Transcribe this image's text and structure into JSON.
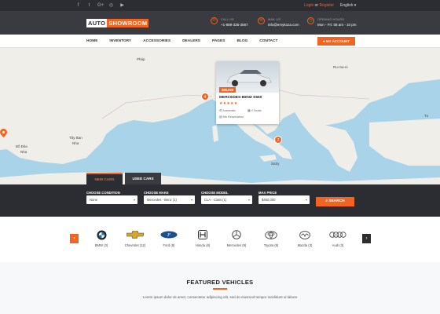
{
  "topbar": {
    "social_icons": [
      "f",
      "t",
      "G+",
      "◎",
      "▶"
    ],
    "login": "Login",
    "or": "or",
    "register": "Register",
    "language": "English"
  },
  "header": {
    "logo_a": "AUTO",
    "logo_b": "SHOWROOM",
    "call_label": "CALL US",
    "call_value": "+1-888-335-3567",
    "mail_label": "MAIL US",
    "mail_value": "info@emykoza.com",
    "hours_label": "OPENING HOURS",
    "hours_value": "Mon - Fri: 08 am - 10 pm"
  },
  "nav": {
    "items": [
      "HOME",
      "INVENTORY",
      "ACCESSORIES",
      "DEALERS",
      "PAGES",
      "BLOG",
      "CONTACT"
    ],
    "account": "MY ACCOUNT"
  },
  "map": {
    "labels": [
      "Pháp",
      "Ru-ma-ni",
      "Tây Ban",
      "Nha",
      "Bồ Đào",
      "Nha",
      "Sicily",
      "Tu"
    ],
    "pins": [
      "4",
      "2"
    ],
    "card": {
      "price": "$90,000",
      "name": "MERCEDES-BENZ S550",
      "stars": "★★★★★",
      "spec1": "Automatic",
      "spec2": "4 Seats",
      "spec3": "6th Reservation"
    }
  },
  "search": {
    "tab_new": "NEW CARS",
    "tab_used": "USED CARS",
    "fields": [
      {
        "label": "CHOOSE CONDITION",
        "value": "None"
      },
      {
        "label": "CHOOSE MAKE",
        "value": "Mercedes - Benz (1)"
      },
      {
        "label": "CHOOSE MODEL",
        "value": "CLA - Class (1)"
      },
      {
        "label": "MAX PRICE",
        "value": "$450,000"
      }
    ],
    "button": "SEARCH"
  },
  "brands": [
    {
      "label": "BMW (3)"
    },
    {
      "label": "Chevrolet (12)"
    },
    {
      "label": "Ford (8)"
    },
    {
      "label": "Honda (6)"
    },
    {
      "label": "Mercedes (9)"
    },
    {
      "label": "Toyota (8)"
    },
    {
      "label": "Mazda (3)"
    },
    {
      "label": "Audi (3)"
    }
  ],
  "featured": {
    "title": "FEATURED VEHICLES",
    "text": "Lorem ipsum dolor sit amet, consectetur adipiscing elit, sed do eiusmod tempor incididunt ut labore"
  },
  "colors": {
    "accent": "#f26422",
    "dark": "#2b2d32",
    "sea": "#a8d3e8",
    "land": "#efeee8"
  }
}
